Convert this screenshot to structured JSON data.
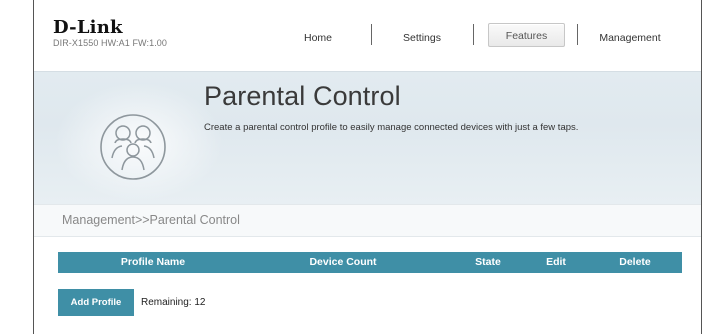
{
  "header": {
    "brand": "D-Link",
    "model_info": "DIR-X1550 HW:A1 FW:1.00",
    "nav": [
      {
        "label": "Home",
        "active": false
      },
      {
        "label": "Settings",
        "active": false
      },
      {
        "label": "Features",
        "active": true
      },
      {
        "label": "Management",
        "active": false
      }
    ]
  },
  "banner": {
    "title": "Parental Control",
    "description": "Create a parental control profile to easily manage connected devices with just a few taps.",
    "icon": "family-icon"
  },
  "breadcrumb": "Management>>Parental Control",
  "table": {
    "columns": [
      "Profile Name",
      "Device Count",
      "State",
      "Edit",
      "Delete"
    ],
    "rows": []
  },
  "actions": {
    "add_profile_label": "Add Profile",
    "remaining_text": "Remaining: 12"
  },
  "colors": {
    "accent": "#3f8fa6",
    "banner_bg": "#e2ebf0"
  }
}
